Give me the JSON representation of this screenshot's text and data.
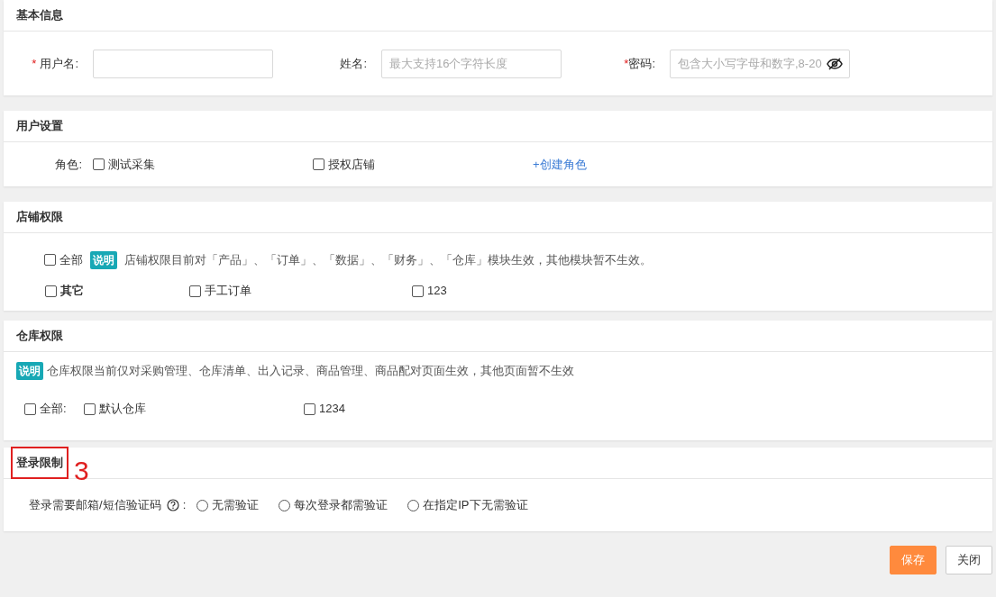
{
  "basic_info": {
    "title": "基本信息",
    "fields": [
      {
        "label": "用户名:",
        "required_mark": "*"
      },
      {
        "label": "姓名:",
        "placeholder": "最大支持16个字符长度"
      },
      {
        "label": "密码:",
        "required_mark": "*",
        "placeholder": "包含大小写字母和数字,8-20",
        "kind": "password"
      }
    ]
  },
  "user_settings": {
    "title": "用户设置",
    "label": "角色:",
    "roles": [
      {
        "label": "测试采集",
        "checked": false
      },
      {
        "label": "授权店铺",
        "checked": false
      }
    ],
    "create_link": "+创建角色"
  },
  "store_permissions": {
    "title": "店铺权限",
    "all": {
      "label": "全部",
      "checked": false
    },
    "note_badge": "说明",
    "note": "店铺权限目前对「产品」、「订单」、「数据」、「财务」、「仓库」模块生效，其他模块暂不生效。",
    "groups": [
      {
        "label": "其它",
        "checked": false
      },
      {
        "label": "手工订单",
        "checked": false
      },
      {
        "label": "123",
        "checked": false
      }
    ]
  },
  "warehouse_permissions": {
    "title": "仓库权限",
    "note_badge": "说明",
    "note": "仓库权限当前仅对采购管理、仓库清单、出入记录、商品管理、商品配对页面生效，其他页面暂不生效",
    "all": {
      "label": "全部:",
      "checked": false
    },
    "warehouses": [
      {
        "label": "默认仓库",
        "checked": false
      },
      {
        "label": "1234",
        "checked": false
      }
    ]
  },
  "login_restriction": {
    "title": "登录限制",
    "annotation": "3",
    "label": "登录需要邮箱/短信验证码",
    "colon": ":",
    "options": [
      {
        "label": "无需验证",
        "selected": false
      },
      {
        "label": "每次登录都需验证",
        "selected": false
      },
      {
        "label": "在指定IP下无需验证",
        "selected": false
      }
    ]
  },
  "buttons": [
    {
      "label": "保存",
      "kind": "primary"
    },
    {
      "label": "关闭",
      "kind": "default"
    }
  ]
}
